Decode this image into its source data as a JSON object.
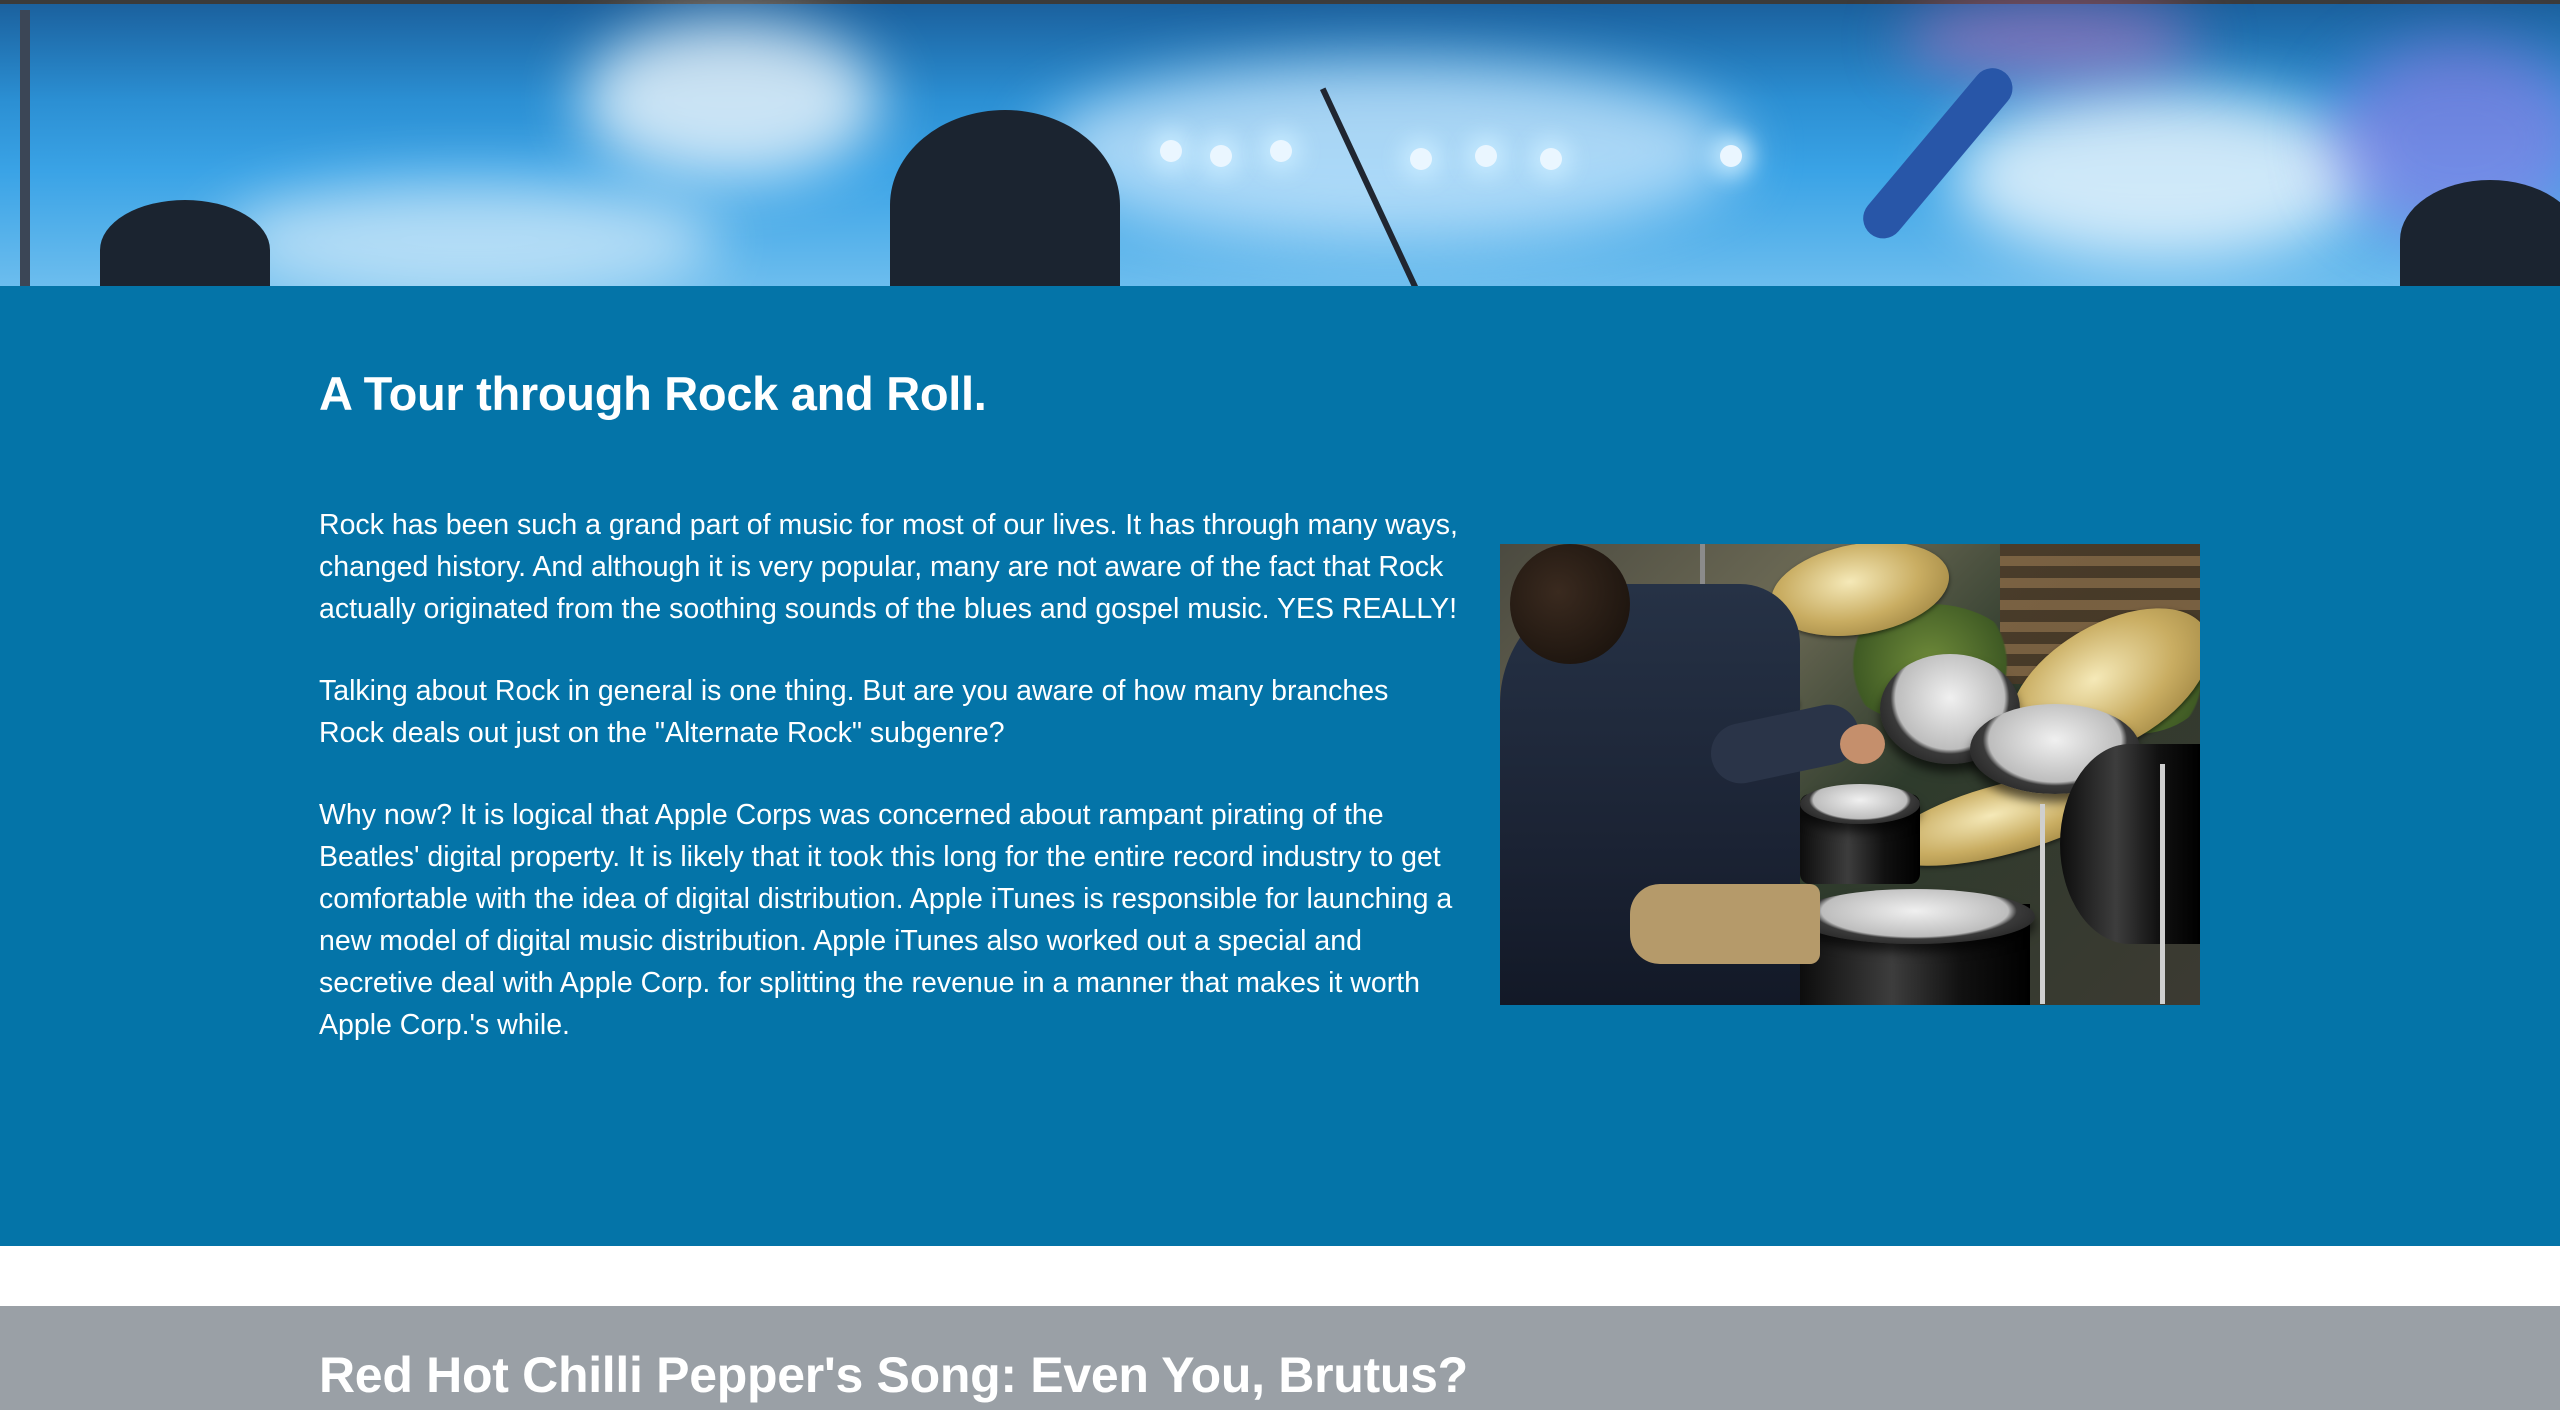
{
  "hero": {
    "image": "rock-concert-stage-icon"
  },
  "intro": {
    "title": "A Tour through Rock and Roll.",
    "paragraphs": [
      "Rock has been such a grand part of music for most of our lives. It has through many ways, changed history. And although it is very popular, many are not aware of the fact that Rock actually originated from the soothing sounds of the blues and gospel music. YES REALLY!",
      "Talking about Rock in general is one thing. But are you aware of how many branches Rock deals out just on the \"Alternate Rock\" subgenre?",
      "Why now? It is logical that Apple Corps was concerned about rampant pirating of the Beatles' digital property. It is likely that it took this long for the entire record industry to get comfortable with the idea of digital distribution. Apple iTunes is responsible for launching a new model of digital music distribution. Apple iTunes also worked out a special and secretive deal with Apple Corp. for splitting the revenue in a manner that makes it worth Apple Corp.'s while."
    ],
    "photo": "drummer-photo-icon"
  },
  "next_section": {
    "title": "Red Hot Chilli Pepper's Song: Even You, Brutus?"
  },
  "colors": {
    "blue_section": "#0474a8",
    "grey_section": "#9aa0a6",
    "text": "#ffffff"
  }
}
